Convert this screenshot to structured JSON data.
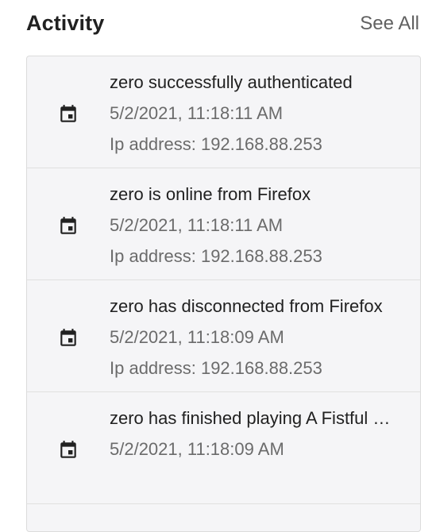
{
  "header": {
    "title": "Activity",
    "see_all_label": "See All"
  },
  "activity": [
    {
      "icon": "calendar-event-icon",
      "title": "zero successfully authenticated",
      "timestamp": "5/2/2021, 11:18:11 AM",
      "ip": "Ip address: 192.168.88.253"
    },
    {
      "icon": "calendar-event-icon",
      "title": "zero is online from Firefox",
      "timestamp": "5/2/2021, 11:18:11 AM",
      "ip": "Ip address: 192.168.88.253"
    },
    {
      "icon": "calendar-event-icon",
      "title": "zero has disconnected from Firefox",
      "timestamp": "5/2/2021, 11:18:09 AM",
      "ip": "Ip address: 192.168.88.253"
    },
    {
      "icon": "calendar-event-icon",
      "title": "zero has finished playing A Fistful …",
      "timestamp": "5/2/2021, 11:18:09 AM",
      "ip": ""
    }
  ]
}
